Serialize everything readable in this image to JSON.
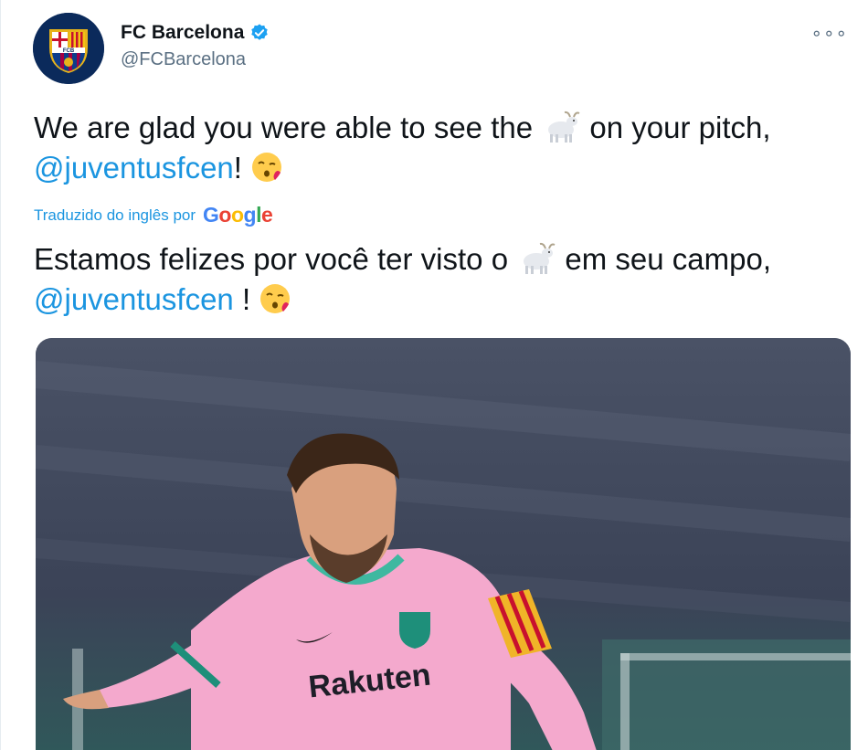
{
  "account": {
    "display_name": "FC Barcelona",
    "handle": "@FCBarcelona",
    "verified": true,
    "avatar_icon": "fc-barcelona-crest-icon",
    "crest_text": "FCB"
  },
  "menu": {
    "more_label": "∘∘∘"
  },
  "tweet": {
    "original_line1": "We are glad you were able to see the",
    "original_line1_end": "on your pitch,",
    "original_mention": "@juventusfcen",
    "original_mention_suffix": "!",
    "translated_by_label": "Traduzido do inglês por",
    "translator_brand": "Google",
    "translated_line1": "Estamos felizes por você ter visto o",
    "translated_line1_end": "em seu campo,",
    "translated_mention": "@juventusfcen",
    "translated_mention_suffix": " !"
  },
  "media": {
    "jersey_sponsor": "Rakuten",
    "description_icon": "photo-player-icon"
  },
  "colors": {
    "mention": "#1b95e0",
    "verified": "#1da1f2",
    "secondary_text": "#5b7083",
    "jersey_pink": "#f4a9cd"
  }
}
